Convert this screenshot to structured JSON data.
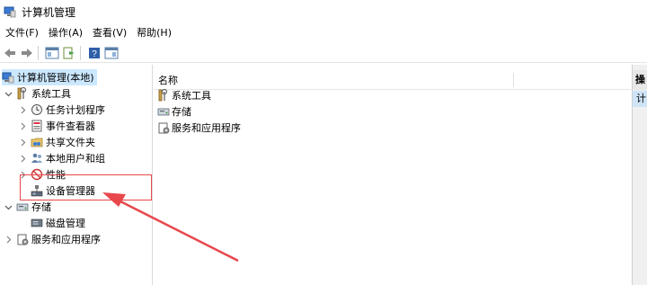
{
  "window": {
    "title": "计算机管理"
  },
  "menu": [
    "文件(F)",
    "操作(A)",
    "查看(V)",
    "帮助(H)"
  ],
  "tree": {
    "root": "计算机管理(本地)",
    "items": [
      {
        "label": "系统工具",
        "expanded": true,
        "level": 1,
        "icon": "tools-icon"
      },
      {
        "label": "任务计划程序",
        "level": 2,
        "icon": "clock-icon"
      },
      {
        "label": "事件查看器",
        "level": 2,
        "icon": "event-viewer-icon"
      },
      {
        "label": "共享文件夹",
        "level": 2,
        "icon": "shared-folder-icon"
      },
      {
        "label": "本地用户和组",
        "level": 2,
        "icon": "users-icon"
      },
      {
        "label": "性能",
        "level": 2,
        "icon": "performance-icon"
      },
      {
        "label": "设备管理器",
        "level": 2,
        "icon": "device-manager-icon"
      },
      {
        "label": "存储",
        "expanded": true,
        "level": 1,
        "icon": "storage-icon"
      },
      {
        "label": "磁盘管理",
        "level": 2,
        "icon": "disk-icon"
      },
      {
        "label": "服务和应用程序",
        "level": 1,
        "icon": "services-icon"
      }
    ]
  },
  "list": {
    "column": "名称",
    "items": [
      "系统工具",
      "存储",
      "服务和应用程序"
    ]
  },
  "actions": {
    "header": "操",
    "item": "计"
  },
  "colors": {
    "selection": "#cce8ff",
    "highlight": "#e8474c",
    "arrow": "#e8474c"
  }
}
